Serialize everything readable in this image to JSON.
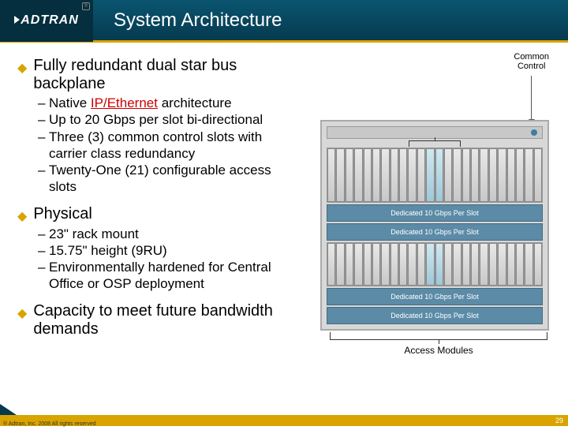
{
  "logo_text": "ADTRAN",
  "logo_r": "®",
  "title": "System Architecture",
  "common_control_label": "Common\nControl",
  "bullets": {
    "b1": "Fully redundant dual star bus backplane",
    "b1s1_pre": "Native ",
    "b1s1_hl": "IP/Ethernet",
    "b1s1_post": " architecture",
    "b1s2": "Up to 20 Gbps per slot bi-directional",
    "b1s3": "Three (3) common control slots with carrier class redundancy",
    "b1s4": "Twenty-One (21) configurable access slots",
    "b2": "Physical",
    "b2s1": "23\" rack mount",
    "b2s2": "15.75\" height (9RU)",
    "b2s3": "Environmentally hardened for Central Office or OSP deployment",
    "b3": "Capacity to meet future bandwidth demands"
  },
  "bands": {
    "b1": "Dedicated 10 Gbps Per Slot",
    "b2": "Dedicated 10 Gbps Per Slot",
    "b3": "Dedicated 10 Gbps Per Slot",
    "b4": "Dedicated 10 Gbps Per Slot"
  },
  "access_modules_label": "Access Modules",
  "copyright": "® Adtran, Inc. 2008 All rights reserved",
  "page_number": "29"
}
